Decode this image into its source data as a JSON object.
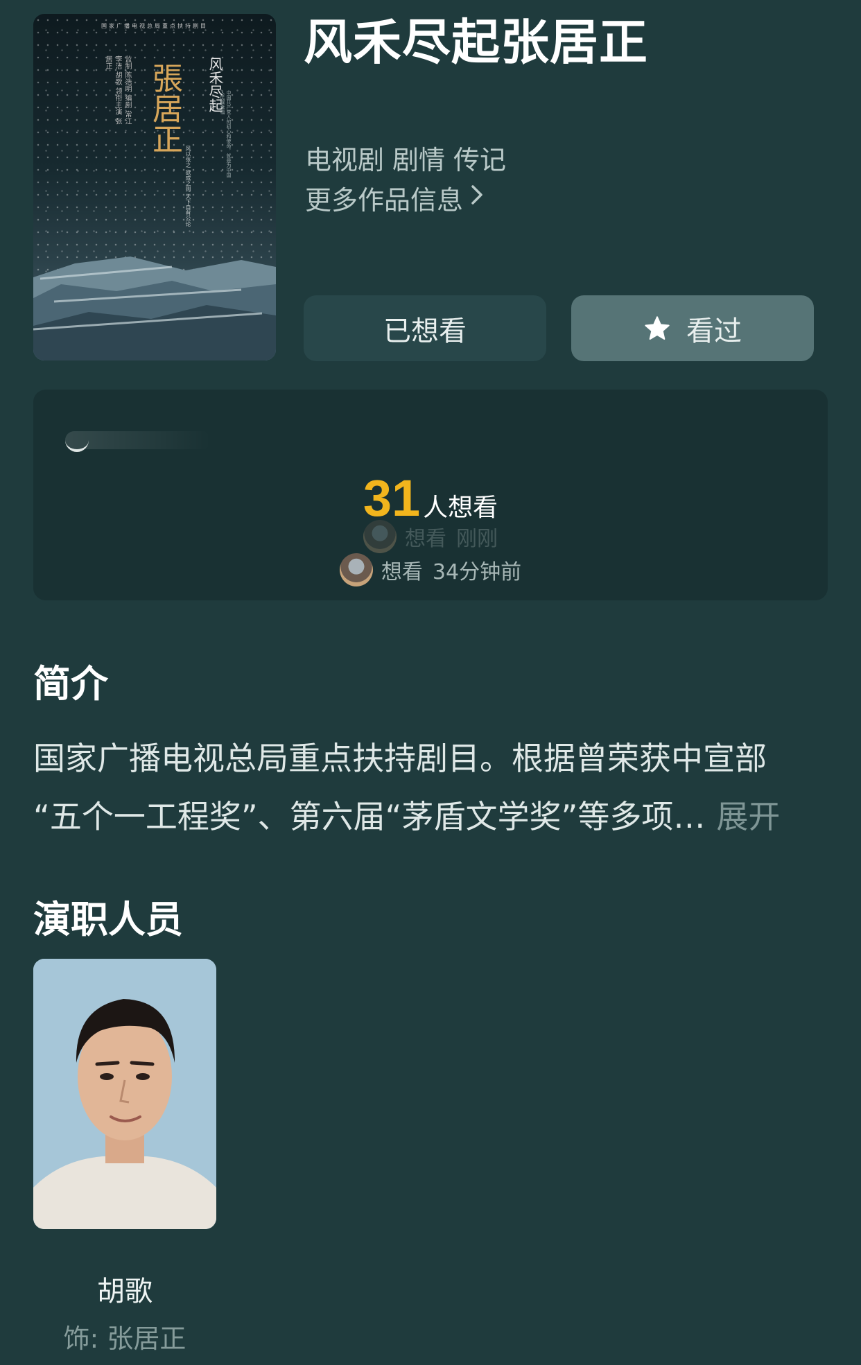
{
  "poster": {
    "top_line": "国家广播电视总局重点扶持剧目",
    "title": "張居正",
    "subtitle": "风禾尽起",
    "credits": "监制 陈浩明 编剧 常江 李洁 胡歌 领衔主演 张居正",
    "desc": "中国共产党人的初心和使命，就是为中国人民谋幸福",
    "desc2": "风以张之 欲成之则 天下自有公论"
  },
  "title": "风禾尽起张居正",
  "genres": [
    "电视剧",
    "剧情",
    "传记"
  ],
  "more_info": "更多作品信息",
  "buttons": {
    "want": "已想看",
    "seen": "看过"
  },
  "stats": {
    "want_count": "31",
    "want_suffix": "人想看",
    "activity_faded": {
      "action": "想看",
      "time": "刚刚"
    },
    "activity_recent": {
      "action": "想看",
      "time": "34分钟前"
    }
  },
  "intro": {
    "heading": "简介",
    "line1": "国家广播电视总局重点扶持剧目。根据曾荣获中宣部",
    "line2": "“五个一工程奖”、第六届“茅盾文学奖”等多项…",
    "expand": "展开"
  },
  "cast": {
    "heading": "演职人员",
    "members": [
      {
        "name": "胡歌",
        "role": "饰: 张居正"
      }
    ]
  },
  "colors": {
    "background": "#1f3b3d",
    "accent_count": "#f2b51d",
    "button_want": "#28474a",
    "button_seen": "#567476"
  },
  "icons": {
    "more_info": "chevron-right-icon",
    "seen": "star-icon"
  }
}
